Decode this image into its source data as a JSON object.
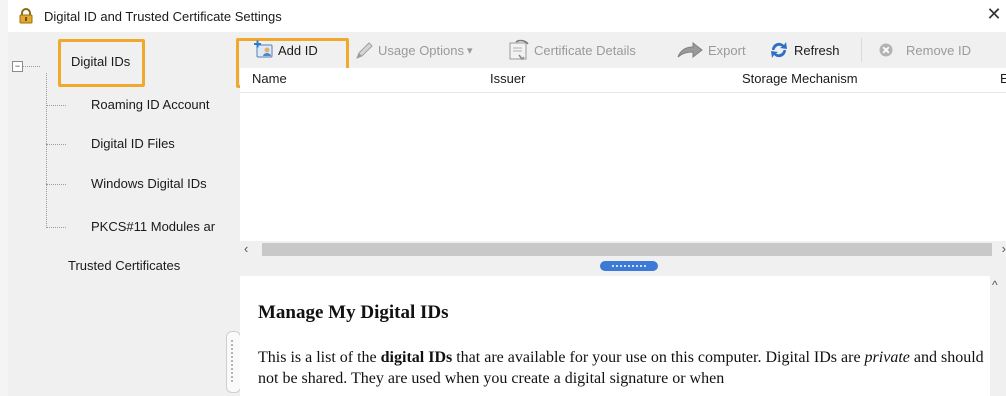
{
  "window": {
    "title": "Digital ID and Trusted Certificate Settings",
    "close_glyph": "✕"
  },
  "tree": {
    "root_label": "Digital IDs",
    "expander_glyph": "⊟",
    "children": [
      "Roaming ID Account",
      "Digital ID Files",
      "Windows Digital IDs",
      "PKCS#11 Modules ar"
    ],
    "trusted_label": "Trusted Certificates"
  },
  "toolbar": {
    "add_id": "Add ID",
    "usage_options": "Usage Options",
    "usage_arrow": "▾",
    "certificate_details": "Certificate Details",
    "export": "Export",
    "refresh": "Refresh",
    "remove_id": "Remove ID"
  },
  "columns": {
    "name": "Name",
    "issuer": "Issuer",
    "storage": "Storage Mechanism",
    "cut_off": "E"
  },
  "scroll": {
    "left_arrow": "‹",
    "right_arrow": "›",
    "up_arrow": "^"
  },
  "info": {
    "title": "Manage My Digital IDs",
    "p_before": "This is a list of the ",
    "p_bold": "digital IDs",
    "p_mid": " that are available for your use on this computer. Digital IDs are ",
    "p_italic": "private",
    "p_after": " and should not be shared. They are used when you create a digital signature or when"
  },
  "colors": {
    "highlight": "#f0a92f",
    "accent_blue": "#3d7ad8",
    "panel_bg": "#f0f0f0"
  },
  "icons": {
    "title": "lock-icon",
    "add_id": "add-id-icon",
    "usage": "pen-icon",
    "certificate": "certificate-icon",
    "export": "export-arrow-icon",
    "refresh": "refresh-icon",
    "remove": "remove-icon"
  }
}
